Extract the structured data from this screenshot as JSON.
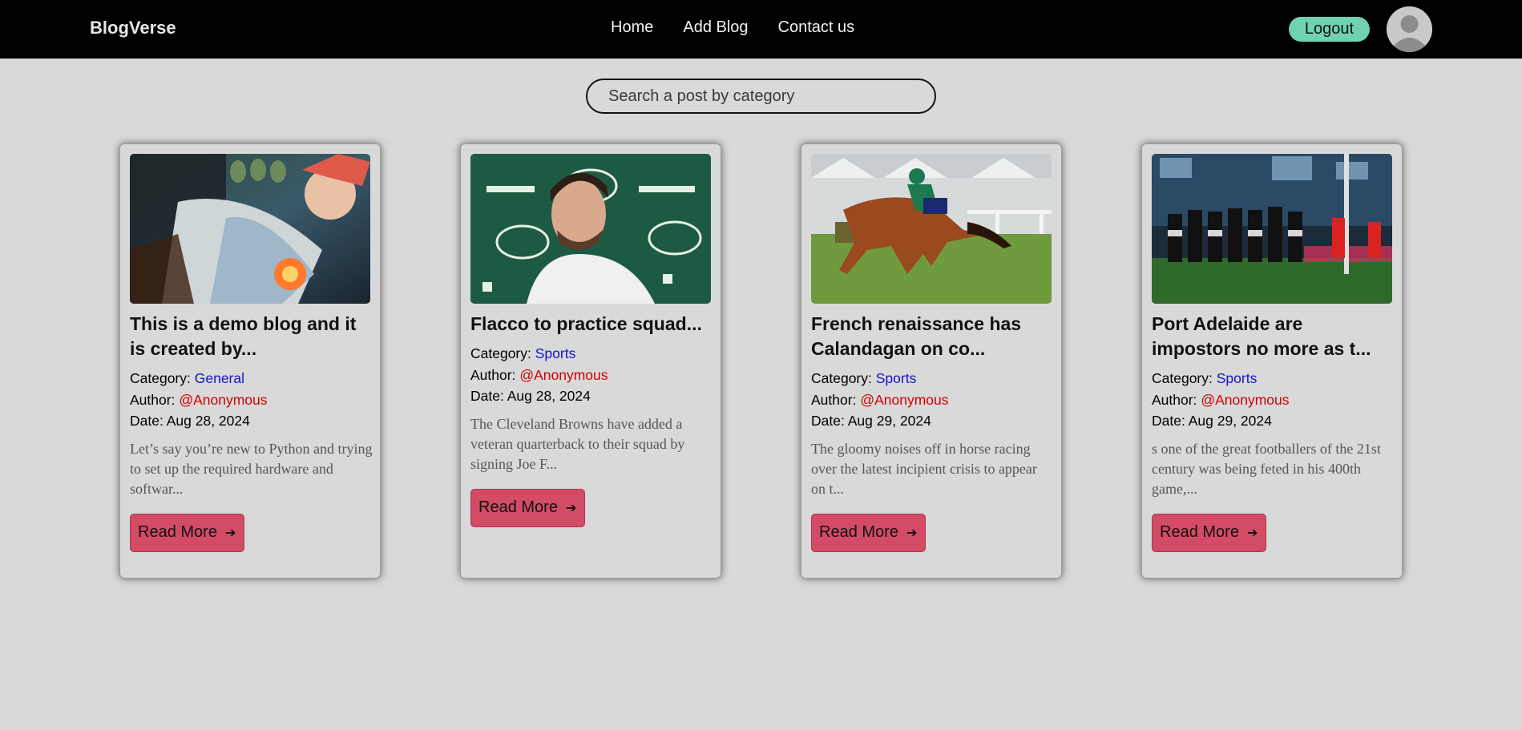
{
  "header": {
    "brand": "BlogVerse",
    "nav": [
      "Home",
      "Add Blog",
      "Contact us"
    ],
    "logout_label": "Logout"
  },
  "search": {
    "placeholder": "Search a post by category"
  },
  "labels": {
    "category": "Category:",
    "author": "Author:",
    "date": "Date:",
    "read_more": "Read More",
    "arrow": "➔"
  },
  "posts": [
    {
      "title": "This is a demo blog and it is created by...",
      "category": "General",
      "author": "@Anonymous",
      "date": "Aug 28, 2024",
      "excerpt": "Let’s say you’re new to Python and trying to set up the required hardware and softwar...",
      "image": "anime-illustration"
    },
    {
      "title": "Flacco to practice squad...",
      "category": "Sports",
      "author": "@Anonymous",
      "date": "Aug 28, 2024",
      "excerpt": "The Cleveland Browns have added a veteran quarterback to their squad by signing Joe F...",
      "image": "press-conference-photo"
    },
    {
      "title": "French renaissance has Calandagan on co...",
      "category": "Sports",
      "author": "@Anonymous",
      "date": "Aug 29, 2024",
      "excerpt": "The gloomy noises off in horse racing over the latest incipient crisis to appear on t...",
      "image": "horse-racing-photo"
    },
    {
      "title": "Port Adelaide are impostors no more as t...",
      "category": "Sports",
      "author": "@Anonymous",
      "date": "Aug 29, 2024",
      "excerpt": "s one of the great footballers of the 21st century was being feted in his 400th game,...",
      "image": "football-team-photo"
    }
  ]
}
